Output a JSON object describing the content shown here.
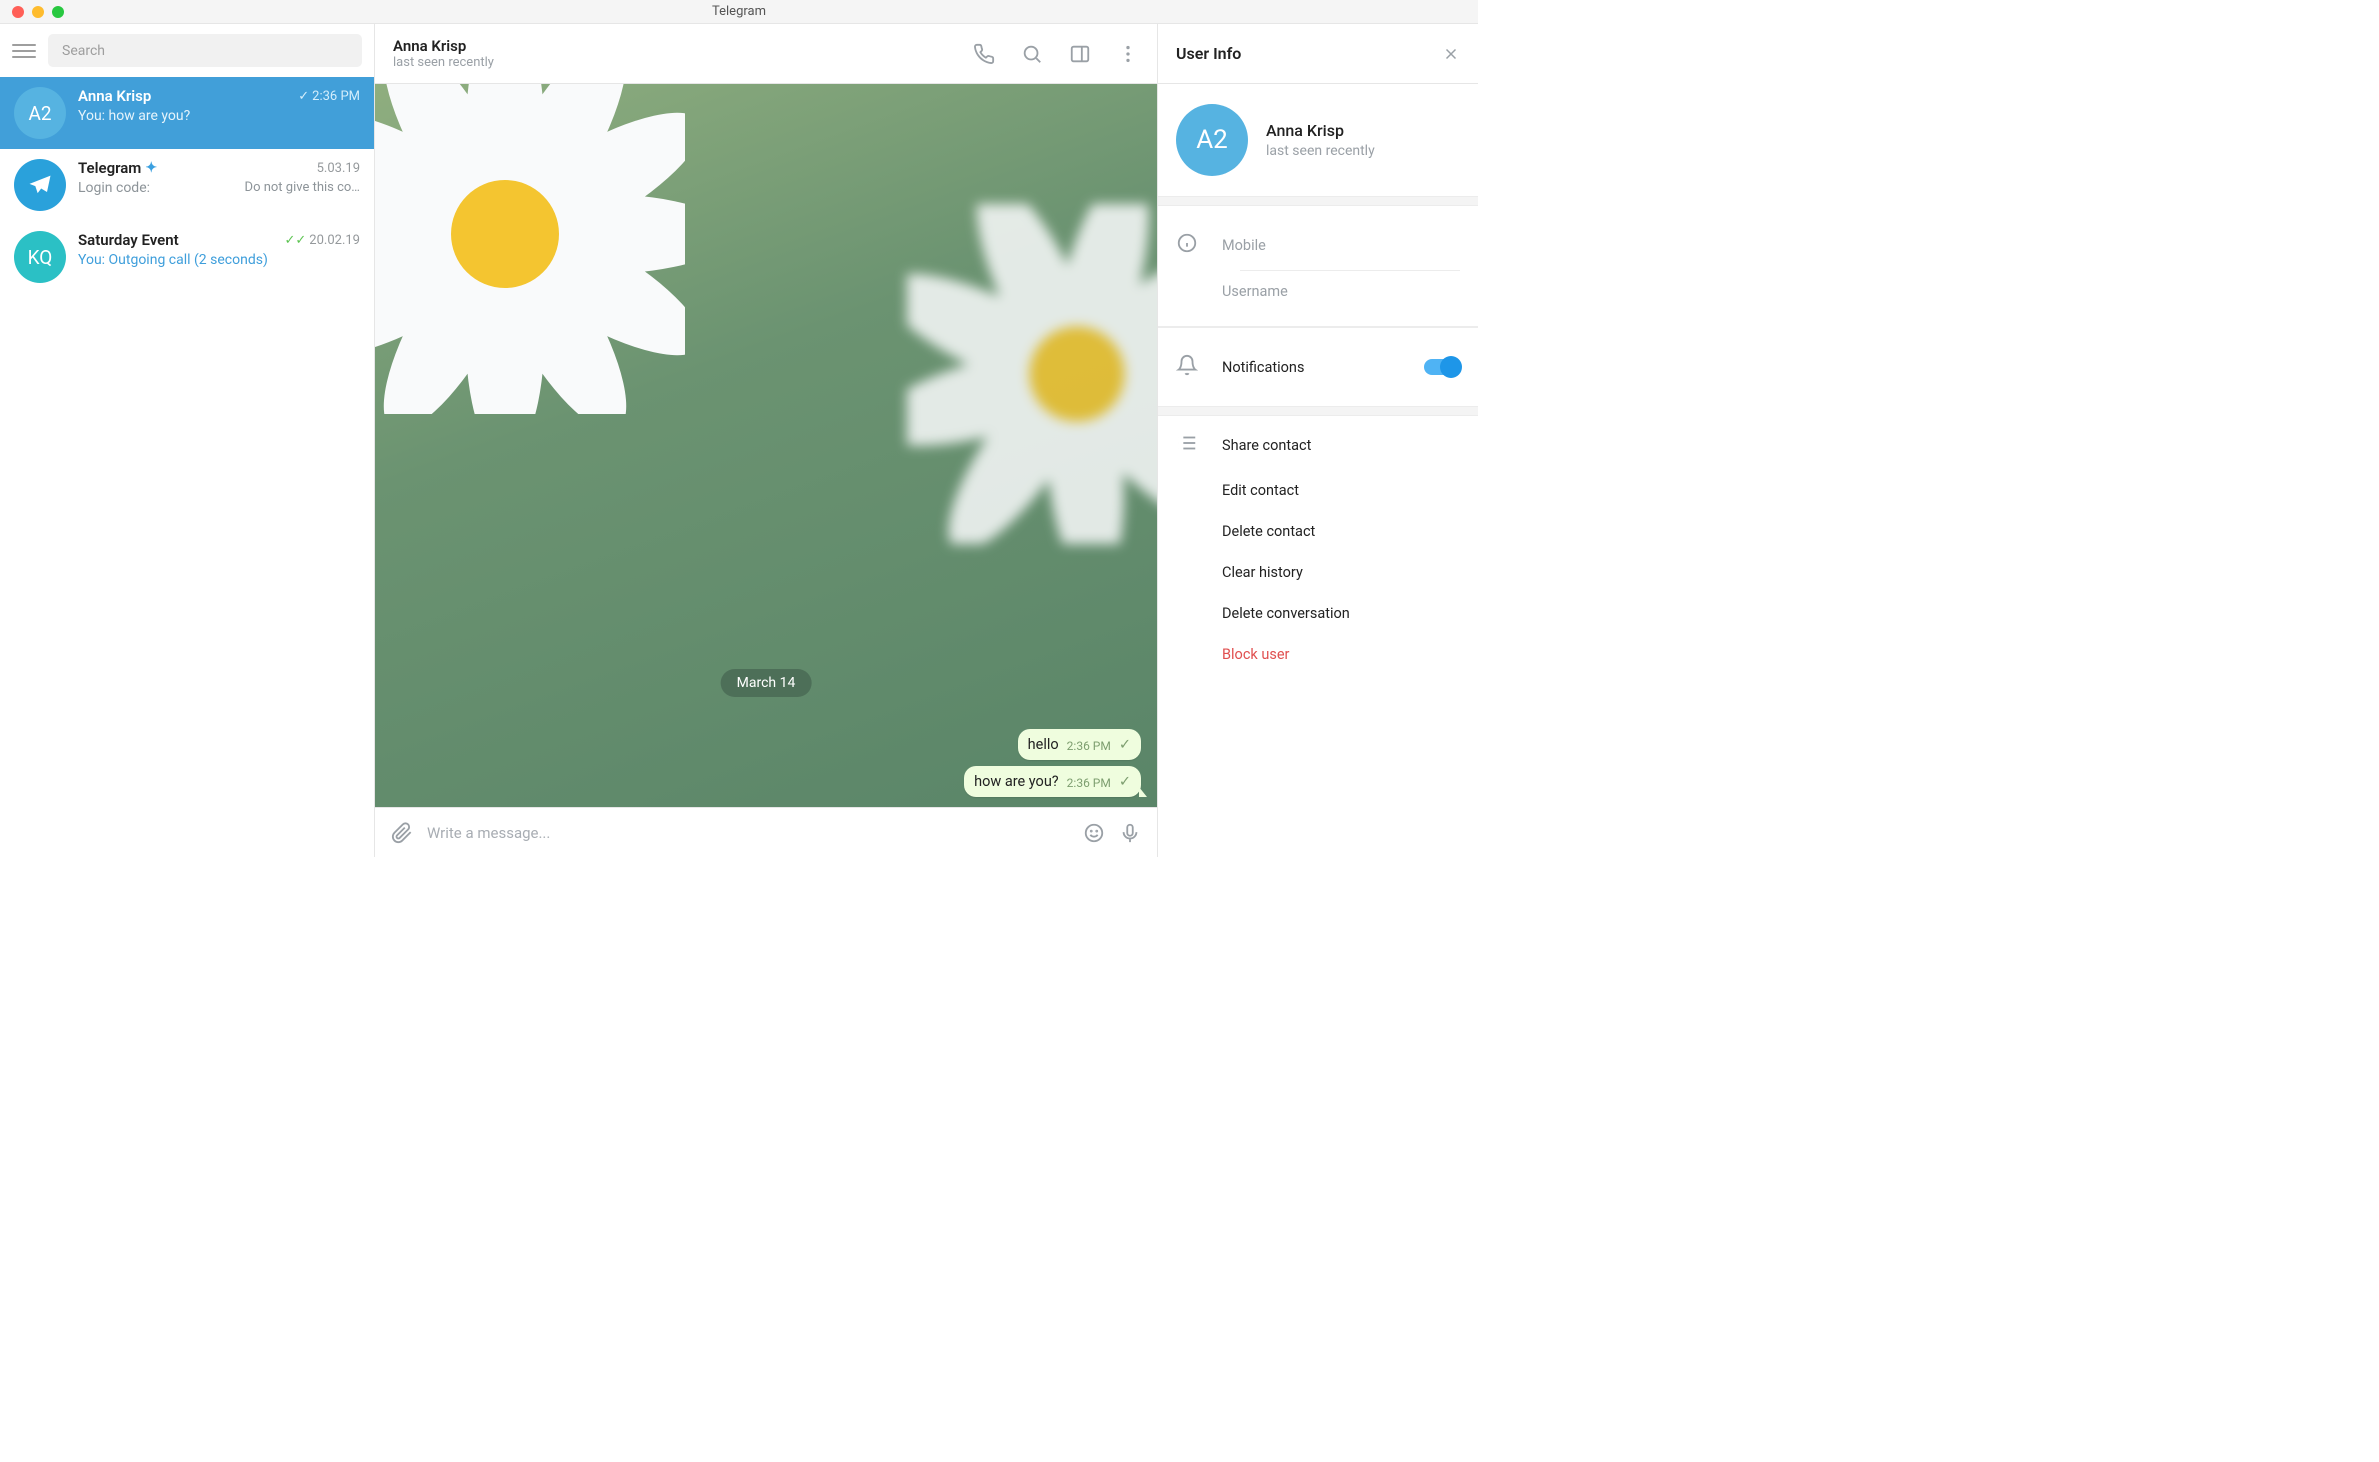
{
  "window": {
    "title": "Telegram"
  },
  "search": {
    "placeholder": "Search"
  },
  "chats": [
    {
      "avatar": "A2",
      "name": "Anna Krisp",
      "time": "2:36 PM",
      "preview_prefix": "You: ",
      "preview": "how are you?",
      "active": true,
      "check": "single"
    },
    {
      "avatar": "tg",
      "name": "Telegram",
      "verified": true,
      "time": "5.03.19",
      "preview_prefix": "Login code: ",
      "preview_side": "Do not give this co…"
    },
    {
      "avatar": "KQ",
      "name": "Saturday Event",
      "time": "20.02.19",
      "preview_prefix": "You: ",
      "preview": "Outgoing call (2 seconds)",
      "check": "double"
    }
  ],
  "conversation": {
    "name": "Anna Krisp",
    "status": "last seen recently",
    "date_separator": "March 14",
    "messages": [
      {
        "text": "hello",
        "time": "2:36 PM"
      },
      {
        "text": "how are you?",
        "time": "2:36 PM"
      }
    ],
    "composer_placeholder": "Write a message..."
  },
  "info": {
    "title": "User Info",
    "avatar": "A2",
    "name": "Anna Krisp",
    "status": "last seen recently",
    "fields": {
      "mobile": "Mobile",
      "username": "Username"
    },
    "notifications_label": "Notifications",
    "actions": {
      "share": "Share contact",
      "edit": "Edit contact",
      "delete_contact": "Delete contact",
      "clear": "Clear history",
      "delete_conv": "Delete conversation",
      "block": "Block user"
    }
  }
}
